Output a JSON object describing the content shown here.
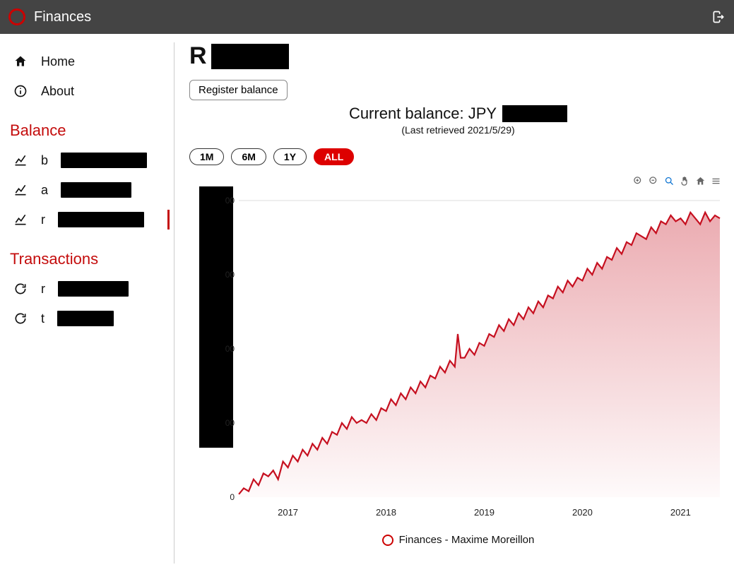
{
  "header": {
    "title": "Finances"
  },
  "sidebar": {
    "home_label": "Home",
    "about_label": "About",
    "section_balance": "Balance",
    "section_transactions": "Transactions"
  },
  "page": {
    "title_prefix": "R",
    "register_button": "Register balance",
    "balance_label_prefix": "Current balance: JPY",
    "last_retrieved": "(Last retrieved 2021/5/29)"
  },
  "ranges": {
    "m1": "1M",
    "m6": "6M",
    "y1": "1Y",
    "all": "ALL",
    "selected": "ALL"
  },
  "footer": {
    "text": "Finances  -  Maxime Moreillon"
  },
  "chart_data": {
    "type": "area",
    "title": "",
    "xlabel": "",
    "ylabel": "",
    "x_ticks": [
      "2017",
      "2018",
      "2019",
      "2020",
      "2021"
    ],
    "x": [
      2016.5,
      2016.55,
      2016.6,
      2016.65,
      2016.7,
      2016.75,
      2016.8,
      2016.85,
      2016.9,
      2016.95,
      2017.0,
      2017.05,
      2017.1,
      2017.15,
      2017.2,
      2017.25,
      2017.3,
      2017.35,
      2017.4,
      2017.45,
      2017.5,
      2017.55,
      2017.6,
      2017.65,
      2017.7,
      2017.75,
      2017.8,
      2017.85,
      2017.9,
      2017.95,
      2018.0,
      2018.05,
      2018.1,
      2018.15,
      2018.2,
      2018.25,
      2018.3,
      2018.35,
      2018.4,
      2018.45,
      2018.5,
      2018.55,
      2018.6,
      2018.65,
      2018.7,
      2018.73,
      2018.76,
      2018.8,
      2018.85,
      2018.9,
      2018.95,
      2019.0,
      2019.05,
      2019.1,
      2019.15,
      2019.2,
      2019.25,
      2019.3,
      2019.35,
      2019.4,
      2019.45,
      2019.5,
      2019.55,
      2019.6,
      2019.65,
      2019.7,
      2019.75,
      2019.8,
      2019.85,
      2019.9,
      2019.95,
      2020.0,
      2020.05,
      2020.1,
      2020.15,
      2020.2,
      2020.25,
      2020.3,
      2020.35,
      2020.4,
      2020.45,
      2020.5,
      2020.55,
      2020.6,
      2020.65,
      2020.7,
      2020.75,
      2020.8,
      2020.85,
      2020.9,
      2020.95,
      2021.0,
      2021.05,
      2021.1,
      2021.15,
      2021.2,
      2021.25,
      2021.3,
      2021.35,
      2021.4
    ],
    "y": [
      0.01,
      0.03,
      0.02,
      0.06,
      0.04,
      0.08,
      0.07,
      0.09,
      0.06,
      0.12,
      0.1,
      0.14,
      0.12,
      0.16,
      0.14,
      0.18,
      0.16,
      0.2,
      0.18,
      0.22,
      0.21,
      0.25,
      0.23,
      0.27,
      0.25,
      0.26,
      0.25,
      0.28,
      0.26,
      0.3,
      0.29,
      0.33,
      0.31,
      0.35,
      0.33,
      0.37,
      0.35,
      0.39,
      0.37,
      0.41,
      0.4,
      0.44,
      0.42,
      0.46,
      0.44,
      0.55,
      0.47,
      0.47,
      0.5,
      0.48,
      0.52,
      0.51,
      0.55,
      0.54,
      0.58,
      0.56,
      0.6,
      0.58,
      0.62,
      0.6,
      0.64,
      0.62,
      0.66,
      0.64,
      0.68,
      0.67,
      0.71,
      0.69,
      0.73,
      0.71,
      0.74,
      0.73,
      0.77,
      0.75,
      0.79,
      0.77,
      0.81,
      0.8,
      0.84,
      0.82,
      0.86,
      0.85,
      0.89,
      0.88,
      0.87,
      0.91,
      0.89,
      0.93,
      0.92,
      0.95,
      0.93,
      0.94,
      0.92,
      0.96,
      0.94,
      0.92,
      0.96,
      0.93,
      0.95,
      0.94
    ],
    "ylim": [
      0,
      1.0
    ],
    "y_zero_label": "0",
    "y_partial_label": "00",
    "colors": {
      "line": "#c61020",
      "fill_top": "rgba(198,16,32,0.35)",
      "fill_bottom": "rgba(198,16,32,0.02)"
    }
  }
}
